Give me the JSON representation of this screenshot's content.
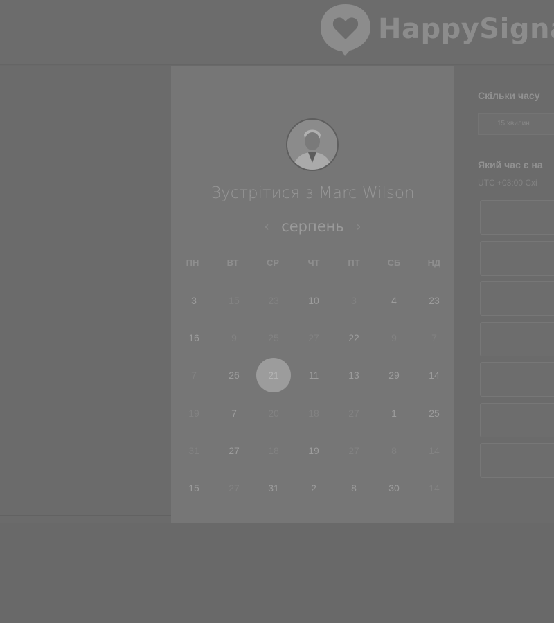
{
  "brand": {
    "name": "HappySigna"
  },
  "booking": {
    "title": "Зустрітися з Marc Wilson",
    "month": "серпень",
    "prev_icon": "chevron-left-icon",
    "next_icon": "chevron-right-icon"
  },
  "calendar": {
    "weekdays": [
      "ПН",
      "ВТ",
      "СР",
      "ЧТ",
      "ПТ",
      "СБ",
      "НД"
    ],
    "weeks": [
      [
        {
          "d": "3",
          "on": true
        },
        {
          "d": "15",
          "on": false
        },
        {
          "d": "23",
          "on": false
        },
        {
          "d": "10",
          "on": true
        },
        {
          "d": "3",
          "on": false
        },
        {
          "d": "4",
          "on": true
        },
        {
          "d": "23",
          "on": true
        }
      ],
      [
        {
          "d": "16",
          "on": true
        },
        {
          "d": "9",
          "on": false
        },
        {
          "d": "25",
          "on": false
        },
        {
          "d": "27",
          "on": false
        },
        {
          "d": "22",
          "on": true
        },
        {
          "d": "9",
          "on": false
        },
        {
          "d": "7",
          "on": false
        }
      ],
      [
        {
          "d": "7",
          "on": false
        },
        {
          "d": "26",
          "on": true
        },
        {
          "d": "21",
          "on": true,
          "selected": true
        },
        {
          "d": "11",
          "on": true
        },
        {
          "d": "13",
          "on": true
        },
        {
          "d": "29",
          "on": true
        },
        {
          "d": "14",
          "on": true
        }
      ],
      [
        {
          "d": "19",
          "on": false
        },
        {
          "d": "7",
          "on": true
        },
        {
          "d": "20",
          "on": false
        },
        {
          "d": "18",
          "on": false
        },
        {
          "d": "27",
          "on": false
        },
        {
          "d": "1",
          "on": true
        },
        {
          "d": "25",
          "on": true
        }
      ],
      [
        {
          "d": "31",
          "on": false
        },
        {
          "d": "27",
          "on": true
        },
        {
          "d": "18",
          "on": false
        },
        {
          "d": "19",
          "on": true
        },
        {
          "d": "27",
          "on": false
        },
        {
          "d": "8",
          "on": false
        },
        {
          "d": "14",
          "on": false
        }
      ],
      [
        {
          "d": "15",
          "on": true
        },
        {
          "d": "27",
          "on": false
        },
        {
          "d": "31",
          "on": true
        },
        {
          "d": "2",
          "on": true
        },
        {
          "d": "8",
          "on": true
        },
        {
          "d": "30",
          "on": true
        },
        {
          "d": "14",
          "on": false
        }
      ]
    ]
  },
  "side": {
    "duration_label": "Скільки часу",
    "duration_value": "15 хвилин",
    "time_label": "Який час є на",
    "timezone": "UTC +03:00 Схі",
    "slot_count": 7
  }
}
